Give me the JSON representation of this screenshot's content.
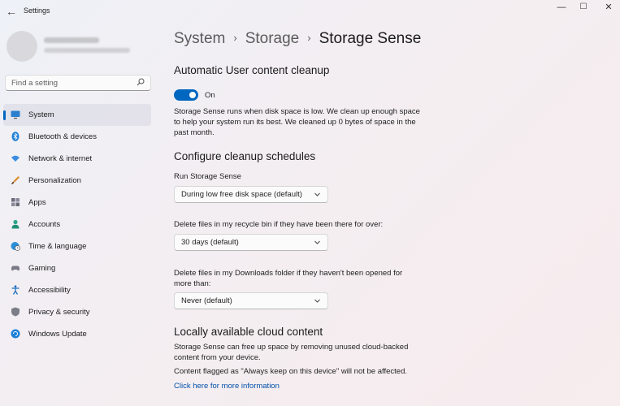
{
  "window": {
    "title": "Settings",
    "back_glyph": "←",
    "min_glyph": "—",
    "max_glyph": "☐",
    "close_glyph": "✕"
  },
  "sidebar": {
    "search_placeholder": "Find a setting",
    "items": [
      {
        "label": "System",
        "icon": "monitor-icon",
        "selected": true
      },
      {
        "label": "Bluetooth & devices",
        "icon": "bluetooth-icon"
      },
      {
        "label": "Network & internet",
        "icon": "wifi-icon"
      },
      {
        "label": "Personalization",
        "icon": "brush-icon"
      },
      {
        "label": "Apps",
        "icon": "apps-icon"
      },
      {
        "label": "Accounts",
        "icon": "person-icon"
      },
      {
        "label": "Time & language",
        "icon": "globe-clock-icon"
      },
      {
        "label": "Gaming",
        "icon": "gamepad-icon"
      },
      {
        "label": "Accessibility",
        "icon": "accessibility-icon"
      },
      {
        "label": "Privacy & security",
        "icon": "shield-icon"
      },
      {
        "label": "Windows Update",
        "icon": "update-icon"
      }
    ]
  },
  "breadcrumb": {
    "items": [
      "System",
      "Storage"
    ],
    "current": "Storage Sense",
    "separator": "›"
  },
  "main": {
    "section1_title": "Automatic User content cleanup",
    "toggle": {
      "state": "On",
      "on": true
    },
    "section1_desc": "Storage Sense runs when disk space is low. We clean up enough space to help your system run its best. We cleaned up 0 bytes of space in the past month.",
    "section2_title": "Configure cleanup schedules",
    "run_label": "Run Storage Sense",
    "run_value": "During low free disk space (default)",
    "recycle_label": "Delete files in my recycle bin if they have been there for over:",
    "recycle_value": "30 days (default)",
    "downloads_label": "Delete files in my Downloads folder if they haven't been opened for more than:",
    "downloads_value": "Never (default)",
    "section3_title": "Locally available cloud content",
    "section3_desc": "Storage Sense can free up space by removing unused cloud-backed content from your device.",
    "section3_note": "Content flagged as \"Always keep on this device\" will not be affected.",
    "more_info_link": "Click here for more information"
  },
  "colors": {
    "accent": "#0067c0",
    "link": "#0050a8"
  }
}
